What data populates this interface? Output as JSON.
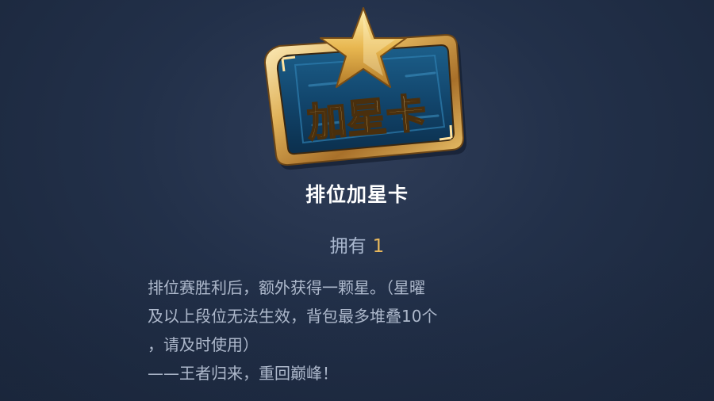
{
  "item": {
    "card_label": "加星卡",
    "name": "排位加星卡",
    "owned_label": "拥有",
    "owned_count": "1",
    "description_lines": [
      "排位赛胜利后，额外获得一颗星。（星曜",
      "及以上段位无法生效，背包最多堆叠10个",
      "，请及时使用）",
      "——王者归来，重回巅峰！"
    ],
    "icon": "star-card-icon"
  },
  "colors": {
    "background": "#223049",
    "gold": "#e9b85c",
    "text_light": "#aeb9cc",
    "title": "#ffffff"
  }
}
